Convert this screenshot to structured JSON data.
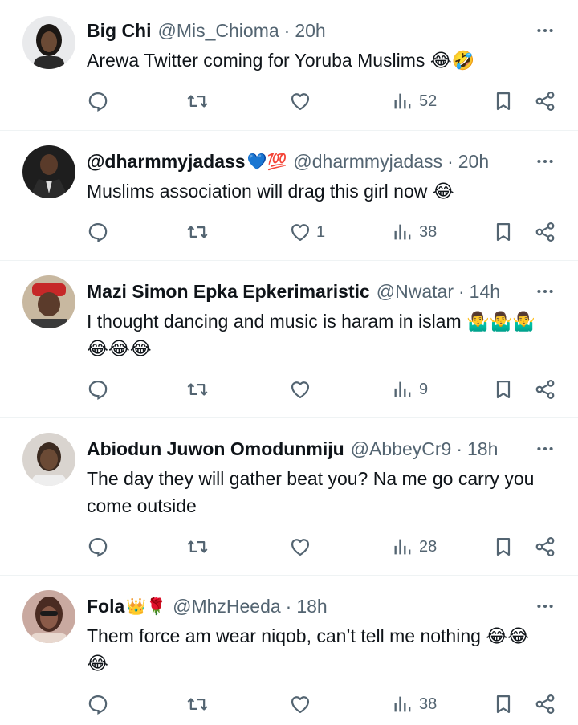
{
  "tweets": [
    {
      "name": "Big Chi",
      "name_emoji": "",
      "handle": "@Mis_Chioma",
      "time": "20h",
      "text": "Arewa Twitter coming for Yoruba Muslims 😂🤣",
      "replies": "",
      "retweets": "",
      "likes": "",
      "views": "52",
      "avatar_colors": [
        "#e9eaec",
        "#1b1714"
      ]
    },
    {
      "name": "@dharmmyjadass",
      "name_emoji": "💙💯",
      "handle": "@dharmmyjadass",
      "time": "20h",
      "text": "Muslims association will drag this girl now 😂",
      "replies": "",
      "retweets": "",
      "likes": "1",
      "views": "38",
      "avatar_colors": [
        "#2a2a2a",
        "#5a3b2a"
      ]
    },
    {
      "name": "Mazi Simon Epka Epkerimaristic",
      "name_emoji": "",
      "handle": "@Nwatar",
      "time": "14h",
      "text": "I thought dancing and music is haram in islam 🤷‍♂️🤷‍♂️🤷‍♂️😂😂😂",
      "replies": "",
      "retweets": "",
      "likes": "",
      "views": "9",
      "avatar_colors": [
        "#c8b8a0",
        "#c62828"
      ]
    },
    {
      "name": "Abiodun Juwon Omodunmiju",
      "name_emoji": "",
      "handle": "@AbbeyCr9",
      "time": "18h",
      "text": "The day they will gather beat you? Na me go carry you come outside",
      "replies": "",
      "retweets": "",
      "likes": "",
      "views": "28",
      "avatar_colors": [
        "#d9d4cf",
        "#3b2a20"
      ]
    },
    {
      "name": "Fola",
      "name_emoji": "👑🌹",
      "handle": "@MhzHeeda",
      "time": "18h",
      "text": "Them force am wear niqob, can’t tell me nothing 😂😂😂",
      "replies": "",
      "retweets": "",
      "likes": "",
      "views": "38",
      "avatar_colors": [
        "#c9a9a0",
        "#4a2b22"
      ]
    }
  ],
  "icons": {
    "reply": "reply-icon",
    "retweet": "retweet-icon",
    "like": "like-icon",
    "views": "views-icon",
    "bookmark": "bookmark-icon",
    "share": "share-icon",
    "more": "more-icon"
  }
}
